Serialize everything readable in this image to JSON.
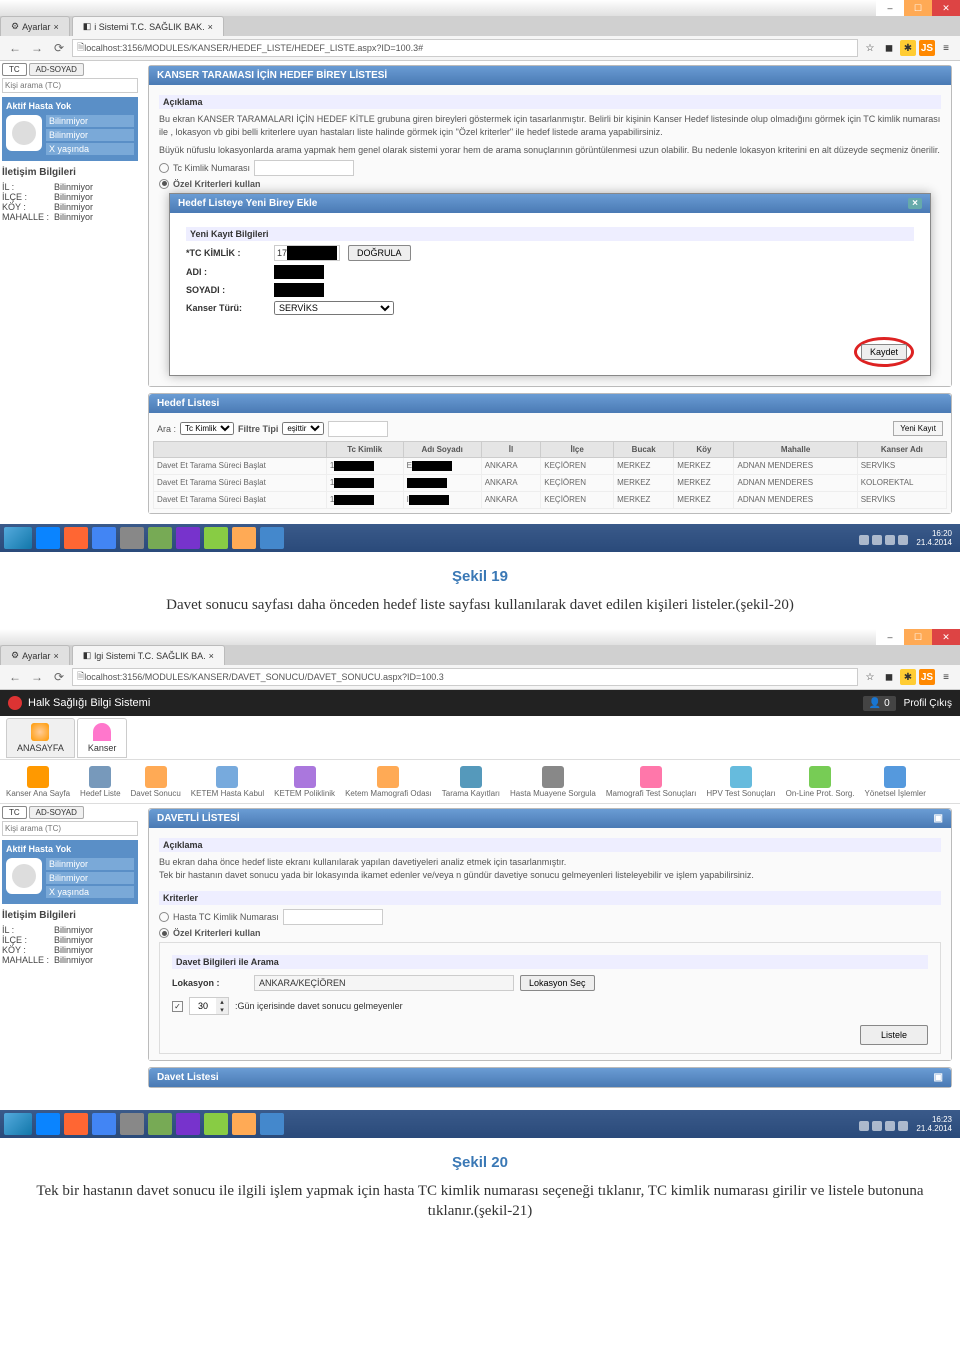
{
  "screenshot1": {
    "browser": {
      "tab1": "Ayarlar",
      "tab2": "i Sistemi T.C. SAĞLIK BAK.",
      "url": "localhost:3156/MODULES/KANSER/HEDEF_LISTE/HEDEF_LISTE.aspx?ID=100.3#"
    },
    "sidebar": {
      "btn_tc": "TC",
      "btn_adsoyad": "AD-SOYAD",
      "search_placeholder": "Kişi arama (TC)",
      "panel_title": "Aktif Hasta Yok",
      "line1": "Bilinmiyor",
      "line2": "Bilinmiyor",
      "line3": "X yaşında",
      "contact_title": "İletişim Bilgileri",
      "il": "İL :",
      "il_v": "Bilinmiyor",
      "ilce": "İLÇE :",
      "ilce_v": "Bilinmiyor",
      "koy": "KÖY :",
      "koy_v": "Bilinmiyor",
      "mah": "MAHALLE :",
      "mah_v": "Bilinmiyor"
    },
    "main_panel_title": "KANSER TARAMASI İÇİN HEDEF BİREY LİSTESİ",
    "aciklama_title": "Açıklama",
    "aciklama_p1": "Bu ekran KANSER TARAMALARI İÇİN HEDEF KİTLE grubuna giren bireyleri göstermek için tasarlanmıştır. Belirli bir kişinin Kanser Hedef listesinde olup olmadığını görmek için TC kimlik numarası ile , lokasyon vb gibi belli kriterlere uyan hastaları liste halinde görmek için \"Özel kriterler\" ile hedef listede arama yapabilirsiniz.",
    "aciklama_p2": "Büyük nüfuslu lokasyonlarda arama yapmak hem genel olarak sistemi yorar hem de arama sonuçlarının görüntülenmesi uzun olabilir. Bu nedenle lokasyon kriterini en alt düzeyde seçmeniz önerilir.",
    "radio_tc": "Tc Kimlik Numarası",
    "radio_ozel": "Özel Kriterleri kullan",
    "modal": {
      "title": "Hedef Listeye Yeni Birey Ekle",
      "section": "Yeni Kayıt Bilgileri",
      "tc": "*TC KİMLİK :",
      "tc_value_prefix": "17",
      "dogrula": "DOĞRULA",
      "adi": "ADI :",
      "soyadi": "SOYADI :",
      "turu": "Kanser Türü:",
      "turu_value": "SERVİKS",
      "kaydet": "Kaydet"
    },
    "hedef_listesi_title": "Hedef Listesi",
    "filter": {
      "ara": "Ara :",
      "ara_opt": "Tc Kimlik",
      "filtre_tipi": "Filtre Tipi",
      "filtre_val": "eşittir",
      "yeni_kayit": "Yeni Kayıt"
    },
    "table": {
      "headers": [
        "",
        "Tc Kimlik",
        "Adı Soyadı",
        "İl",
        "İlçe",
        "Bucak",
        "Köy",
        "Mahalle",
        "Kanser Adı"
      ],
      "rows": [
        [
          "Davet Et Tarama Süreci Başlat",
          "1_",
          "E_",
          "ANKARA",
          "KEÇİÖREN",
          "MERKEZ",
          "MERKEZ",
          "ADNAN MENDERES",
          "SERVİKS"
        ],
        [
          "Davet Et Tarama Süreci Başlat",
          "1_",
          "_",
          "ANKARA",
          "KEÇİÖREN",
          "MERKEZ",
          "MERKEZ",
          "ADNAN MENDERES",
          "KOLOREKTAL"
        ],
        [
          "Davet Et Tarama Süreci Başlat",
          "1_",
          "I_",
          "ANKARA",
          "KEÇİÖREN",
          "MERKEZ",
          "MERKEZ",
          "ADNAN MENDERES",
          "SERVİKS"
        ]
      ]
    },
    "clock": {
      "time": "16:20",
      "date": "21.4.2014"
    }
  },
  "caption1": "Şekil 19",
  "para1": "Davet sonucu sayfası daha önceden hedef liste sayfası kullanılarak davet edilen kişileri listeler.(şekil-20)",
  "screenshot2": {
    "browser": {
      "tab1": "Ayarlar",
      "tab2": "lgi Sistemi T.C. SAĞLIK BA.",
      "url": "localhost:3156/MODULES/KANSER/DAVET_SONUCU/DAVET_SONUCU.aspx?ID=100.3"
    },
    "topbar": {
      "app": "Halk Sağlığı Bilgi Sistemi",
      "user_count": "0",
      "logout": "Profil Çıkış"
    },
    "nav": {
      "anasayfa": "ANASAYFA",
      "kanser": "Kanser"
    },
    "toolbar": [
      "Kanser Ana Sayfa",
      "Hedef Liste",
      "Davet Sonucu",
      "KETEM Hasta Kabul",
      "KETEM Poliklinik",
      "Ketem Mamografi Odası",
      "Tarama Kayıtları",
      "Hasta Muayene Sorgula",
      "Mamografi Test Sonuçları",
      "HPV Test Sonuçları",
      "On-Line Prot. Sorg.",
      "Yönetsel İşlemler"
    ],
    "panel_title": "DAVETLİ LİSTESİ",
    "aciklama_title": "Açıklama",
    "aciklama": "Bu ekran daha önce hedef liste ekranı kullanılarak yapılan davetiyeleri analiz etmek için tasarlanmıştır.\nTek bir hastanın davet sonucu yada bir lokasyında ikamet edenler ve/veya n gündür davetiye sonucu gelmeyenleri listeleyebilir ve işlem yapabilirsiniz.",
    "kriterler": "Kriterler",
    "radio_hasta": "Hasta TC Kimlik Numarası",
    "radio_ozel": "Özel Kriterleri kullan",
    "davet_arama": "Davet Bilgileri ile Arama",
    "lokasyon_lbl": "Lokasyon :",
    "lokasyon_val": "ANKARA/KEÇİÖREN",
    "lokasyon_btn": "Lokasyon Seç",
    "gun_val": "30",
    "gun_txt": ":Gün içerisinde davet sonucu gelmeyenler",
    "listele": "Listele",
    "davet_listesi": "Davet Listesi",
    "clock": {
      "time": "16:23",
      "date": "21.4.2014"
    }
  },
  "caption2": "Şekil 20",
  "para2": "Tek bir hastanın davet sonucu ile ilgili işlem yapmak için hasta TC kimlik numarası seçeneği tıklanır, TC kimlik numarası girilir ve listele butonuna tıklanır.(şekil-21)"
}
